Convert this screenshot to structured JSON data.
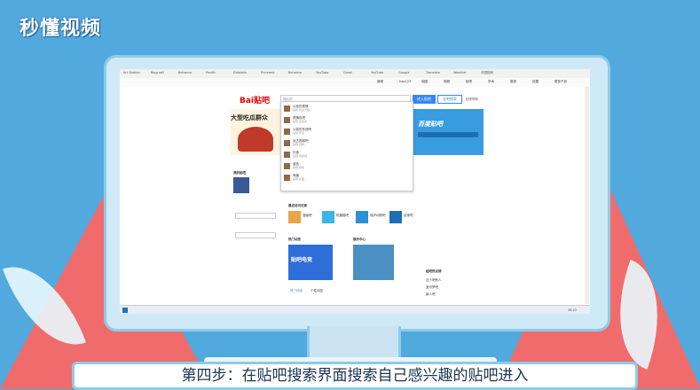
{
  "brand": {
    "logo_text": "秒懂视频"
  },
  "caption": "第四步：在贴吧搜索界面搜索自己感兴趣的贴吧进入",
  "colors": {
    "background": "#52a9dd",
    "accent": "#3385ff",
    "triangle": "#f06c6c"
  },
  "browser": {
    "bookmarks": [
      "Art Station",
      "Bagcraft",
      "Behance",
      "Pacific",
      "Dribbble",
      "Pinterest",
      "Behance",
      "YouTube",
      "Gmail",
      "YouTube",
      "Google",
      "Translate",
      "Weather",
      "中国知网"
    ],
    "nav_links": [
      "新闻",
      "hao123",
      "地图",
      "视频",
      "贴吧",
      "学术",
      "登录",
      "设置",
      "更多产品"
    ]
  },
  "tieba": {
    "logo": "Bai贴吧",
    "search_placeholder": "搜贴吧",
    "enter_button": "进入贴吧",
    "search_button": "全吧搜索",
    "help_link": "贴吧帮助",
    "banner_text": "大型吃瓜群众",
    "promo_text": "百度贴吧",
    "dropdown": [
      {
        "title": "以前的表情",
        "sub": "贴吧·欢迎光临"
      },
      {
        "title": "表情包吧",
        "sub": "贴吧·表情包"
      },
      {
        "title": "以前的东西吧",
        "sub": "贴吧·怀旧"
      },
      {
        "title": "远古视频吧",
        "sub": "贴吧·视频"
      },
      {
        "title": "抖音",
        "sub": "贴吧·短视频"
      },
      {
        "title": "蓝色",
        "sub": "贴吧·颜色"
      },
      {
        "title": "有趣",
        "sub": "贴吧·有趣"
      }
    ],
    "sections": {
      "my_tieba": "我的贴吧",
      "recent": "最近访问记录",
      "hot": "热门动态",
      "live": "娱乐中心",
      "hot_list": "贴吧热议榜",
      "tabs": [
        "热门动态",
        "个性动态"
      ]
    },
    "recent_items": [
      "漫画吧",
      "机器猫吧",
      "保护动物吧",
      "足球吧"
    ],
    "live_banner": "贴吧电竞",
    "hot_list_items": [
      "这个吧有人",
      "宝可梦吧",
      "新人吧"
    ]
  },
  "taskbar": {
    "time": "15:21"
  }
}
